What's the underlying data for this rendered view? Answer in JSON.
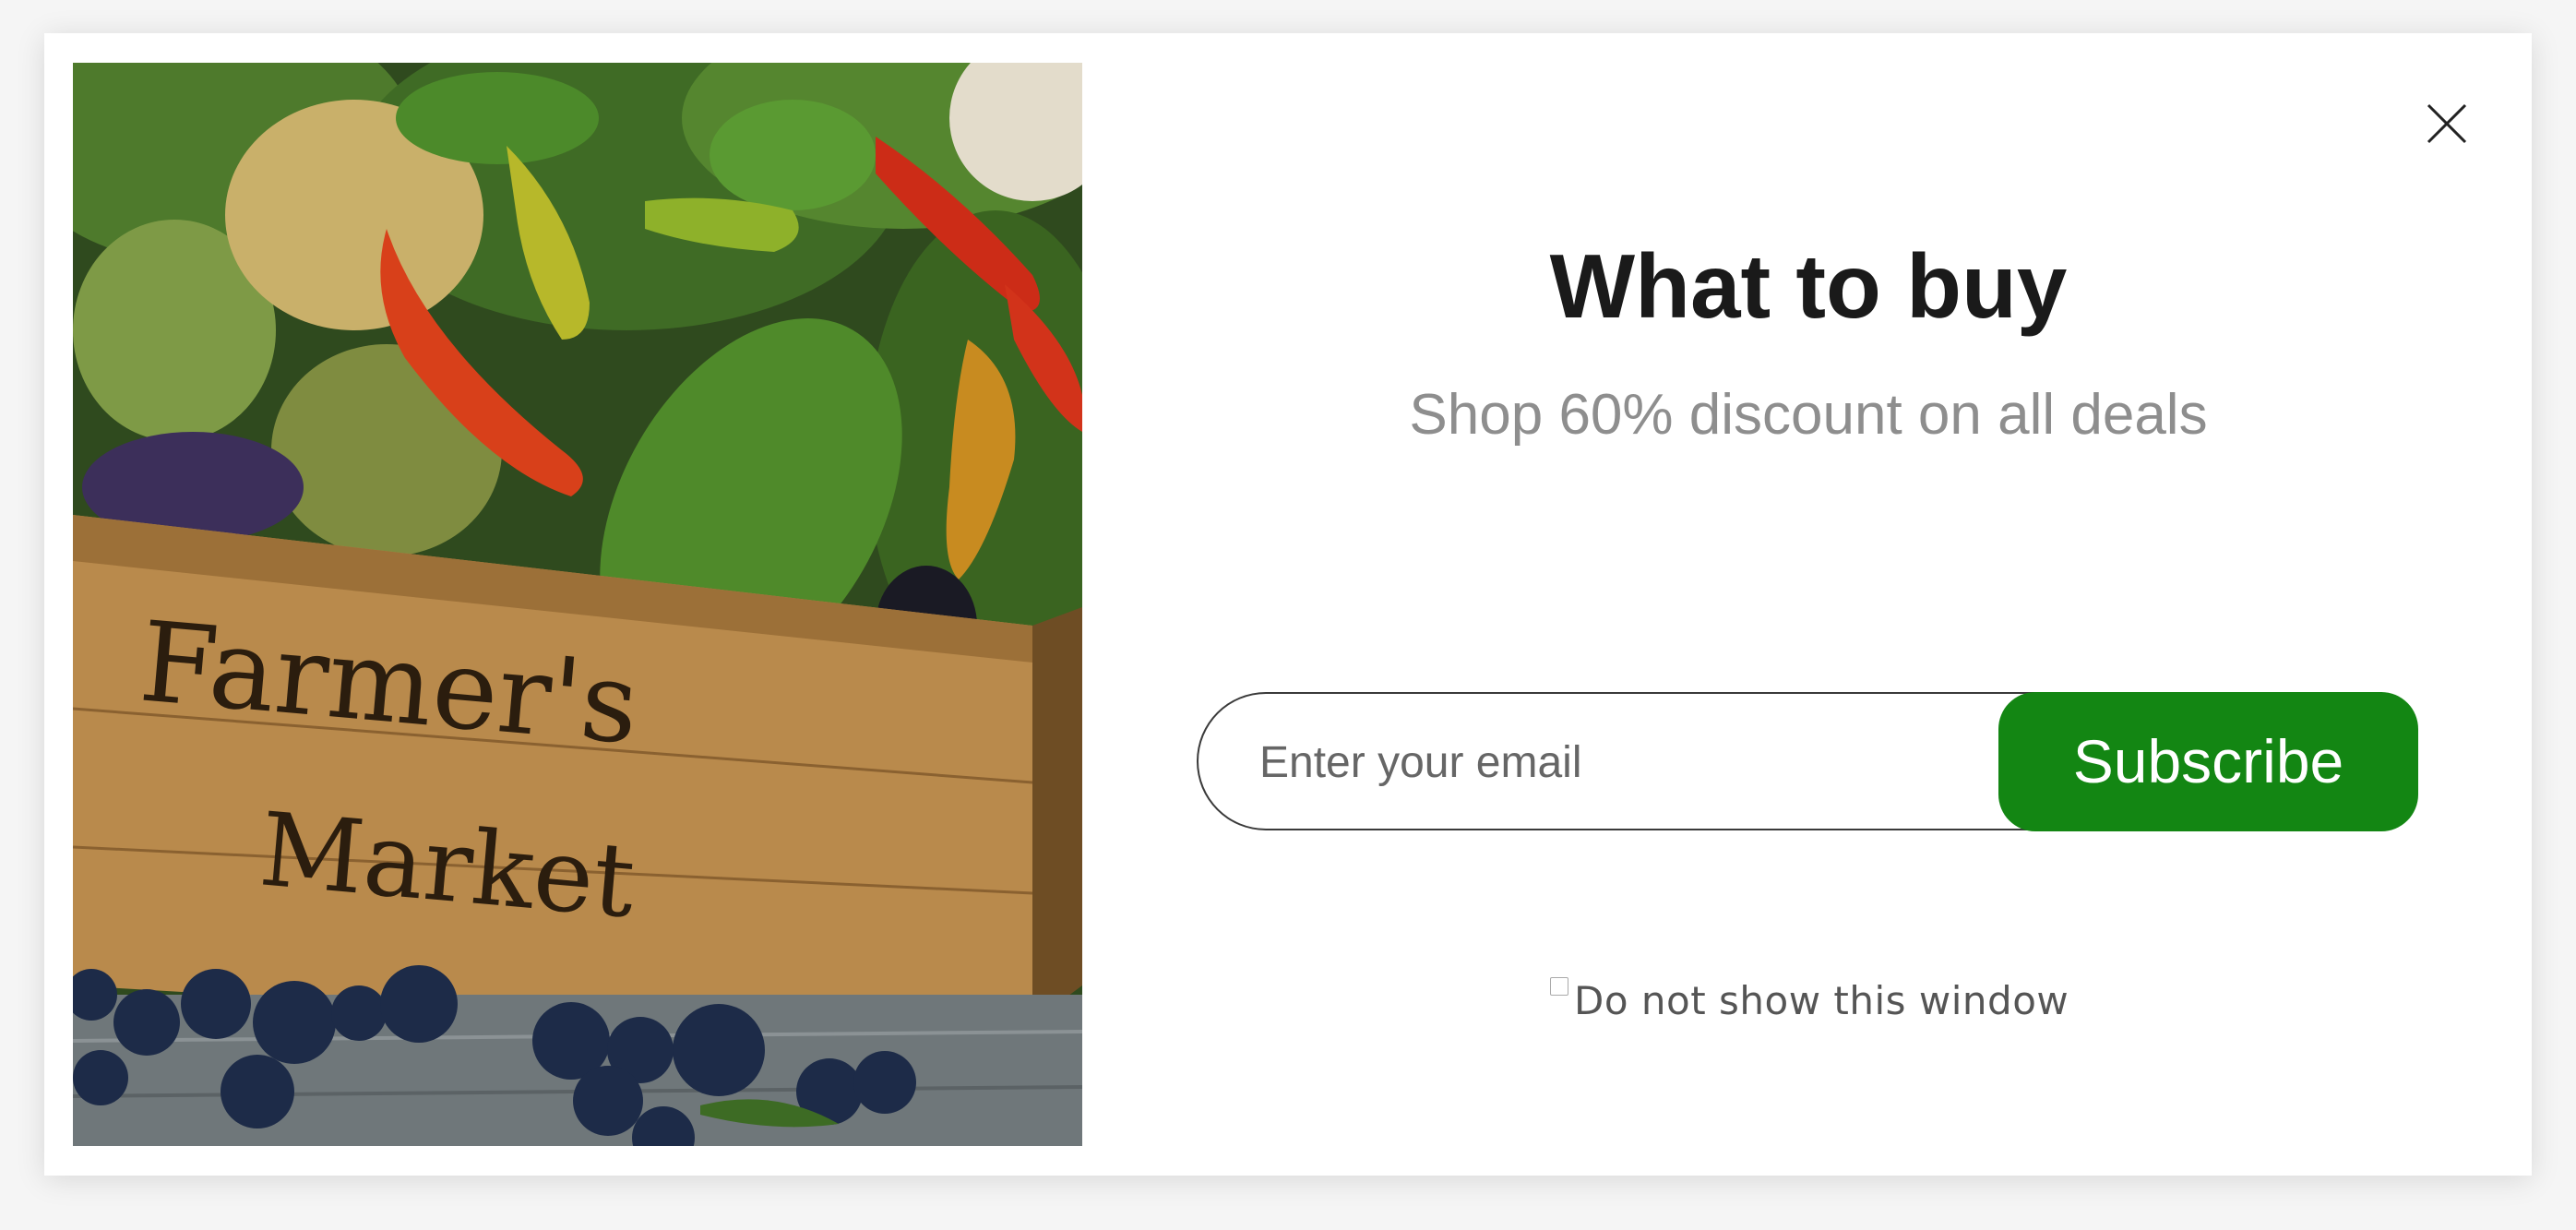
{
  "popup": {
    "title": "What to buy",
    "subtitle": "Shop 60% discount on all deals",
    "email": {
      "placeholder": "Enter your email",
      "value": ""
    },
    "subscribe_label": "Subscribe",
    "dont_show_label": "Do not show this window",
    "dont_show_checked": false,
    "close_icon": "close-icon",
    "image": {
      "crate_text_line1": "Farmer's",
      "crate_text_line2": "Market"
    }
  },
  "colors": {
    "accent": "#138613",
    "title": "#1a1a1a",
    "subtitle": "#8e8e8e"
  }
}
